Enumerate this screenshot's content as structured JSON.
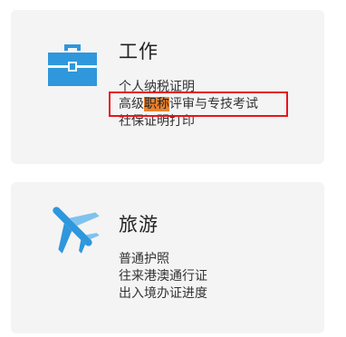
{
  "colors": {
    "card_bg": "#f4f4f4",
    "icon_blue": "#2f97dc",
    "icon_light_blue": "#7fc2ee",
    "highlight": "#e8822e",
    "box_red": "#e8141a"
  },
  "cards": [
    {
      "title": "工作",
      "icon": "briefcase-icon",
      "links": [
        {
          "label": "个人纳税证明"
        },
        {
          "before": "高级",
          "highlight": "职称",
          "after": "评审与专技考试"
        },
        {
          "label": "社保证明打印"
        }
      ]
    },
    {
      "title": "旅游",
      "icon": "airplane-icon",
      "links": [
        {
          "label": "普通护照"
        },
        {
          "label": "往来港澳通行证"
        },
        {
          "label": "出入境办证进度"
        }
      ]
    }
  ]
}
